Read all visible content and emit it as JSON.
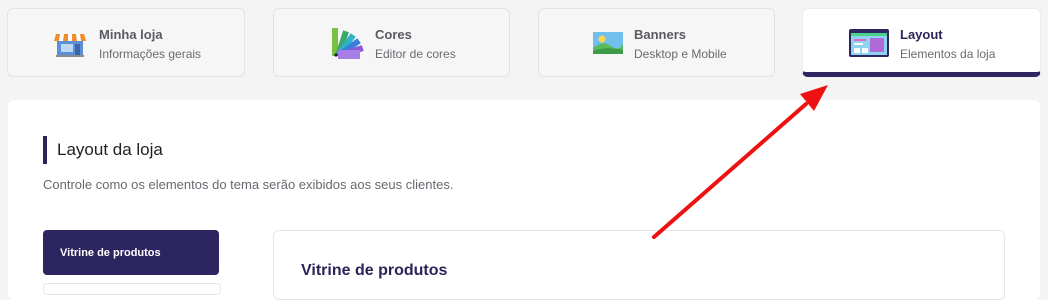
{
  "tabs": [
    {
      "title": "Minha loja",
      "subtitle": "Informações gerais",
      "icon": "store-icon"
    },
    {
      "title": "Cores",
      "subtitle": "Editor de cores",
      "icon": "color-palette-icon"
    },
    {
      "title": "Banners",
      "subtitle": "Desktop e Mobile",
      "icon": "image-icon"
    },
    {
      "title": "Layout",
      "subtitle": "Elementos da loja",
      "icon": "layout-icon",
      "active": true
    }
  ],
  "section": {
    "title": "Layout da loja",
    "description": "Controle como os elementos do tema serão exibidos aos seus clientes."
  },
  "sidebar": {
    "items": [
      {
        "label": "Vitrine de produtos",
        "active": true
      }
    ]
  },
  "card": {
    "title": "Vitrine de produtos"
  },
  "colors": {
    "accent": "#2c2560",
    "annotation_arrow": "#ee1111"
  }
}
